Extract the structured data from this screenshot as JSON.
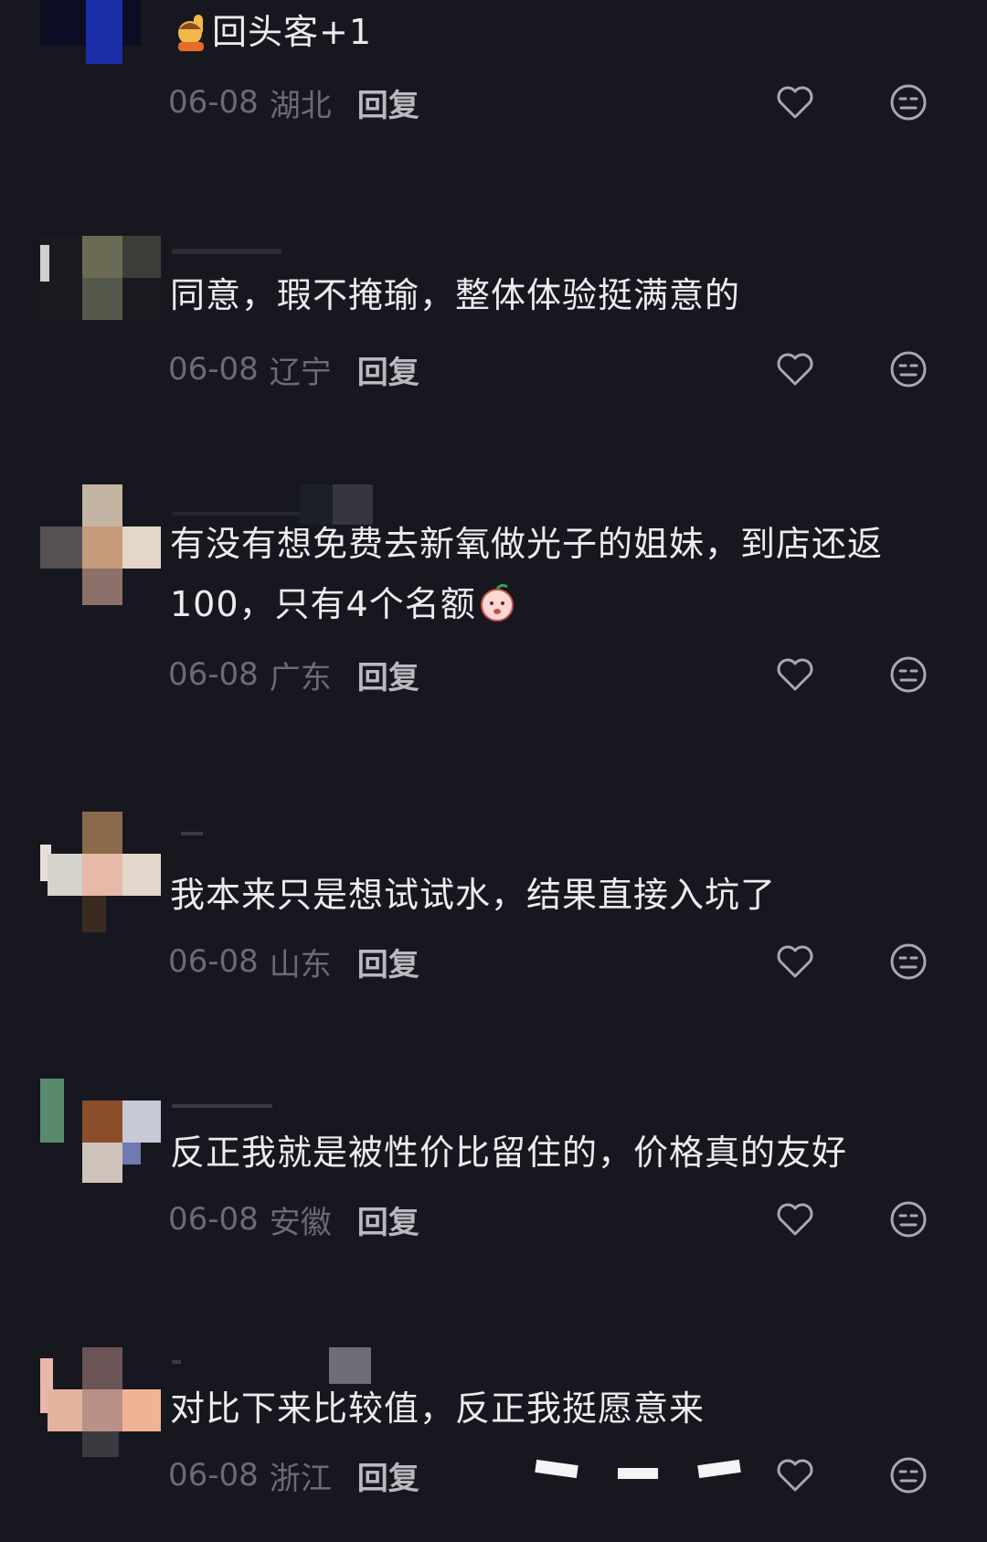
{
  "comments": [
    {
      "text": "回头客+1",
      "date": "06-08",
      "location": "湖北",
      "reply": "回复",
      "has_raise_hand_emoji": true
    },
    {
      "text": "同意，瑕不掩瑜，整体体验挺满意的",
      "date": "06-08",
      "location": "辽宁",
      "reply": "回复"
    },
    {
      "text_line1": "有没有想免费去新氧做光子的姐妹，到店还返",
      "text_line2": "100，只有4个名额",
      "date": "06-08",
      "location": "广东",
      "reply": "回复",
      "has_peach_emoji": true
    },
    {
      "text": "我本来只是想试试水，结果直接入坑了",
      "date": "06-08",
      "location": "山东",
      "reply": "回复"
    },
    {
      "text": "反正我就是被性价比留住的，价格真的友好",
      "date": "06-08",
      "location": "安徽",
      "reply": "回复"
    },
    {
      "text": "对比下来比较值，反正我挺愿意来",
      "date": "06-08",
      "location": "浙江",
      "reply": "回复"
    }
  ],
  "icons": {
    "like": "heart-outline-icon",
    "dislike": "meh-face-icon"
  },
  "colors": {
    "background": "#17171f",
    "text": "#ececf0",
    "meta": "#6b6b73",
    "reply": "#b9b9c0"
  }
}
